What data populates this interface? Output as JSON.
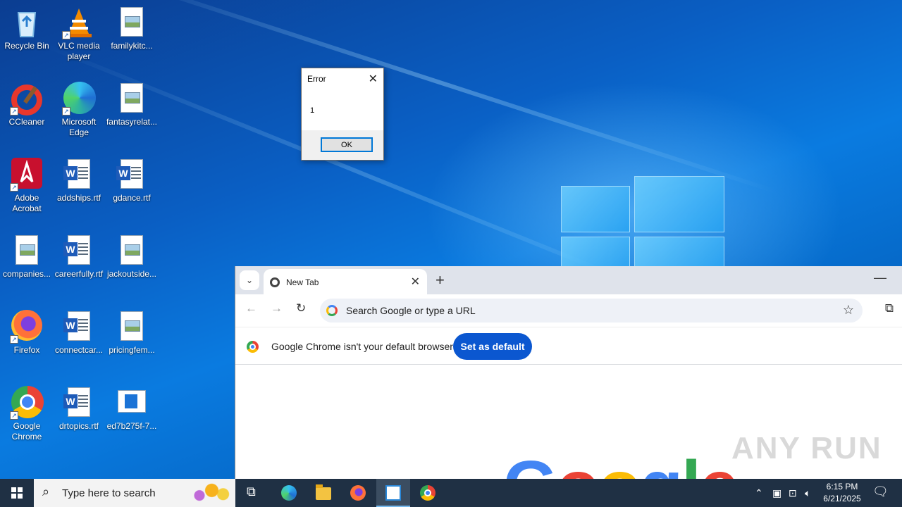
{
  "desktop": {
    "icons": [
      {
        "label": "Recycle Bin",
        "icon": "recycle-bin-icon"
      },
      {
        "label": "VLC media player",
        "icon": "vlc-icon"
      },
      {
        "label": "familykitc...",
        "icon": "image-file-icon"
      },
      {
        "label": "CCleaner",
        "icon": "ccleaner-icon"
      },
      {
        "label": "Microsoft Edge",
        "icon": "edge-icon"
      },
      {
        "label": "fantasyrelat...",
        "icon": "image-file-icon"
      },
      {
        "label": "Adobe Acrobat",
        "icon": "acrobat-icon"
      },
      {
        "label": "addships.rtf",
        "icon": "word-doc-icon"
      },
      {
        "label": "gdance.rtf",
        "icon": "word-doc-icon"
      },
      {
        "label": "companies...",
        "icon": "image-file-icon"
      },
      {
        "label": "careerfully.rtf",
        "icon": "word-doc-icon"
      },
      {
        "label": "jackoutside...",
        "icon": "image-file-icon"
      },
      {
        "label": "Firefox",
        "icon": "firefox-icon"
      },
      {
        "label": "connectcar...",
        "icon": "word-doc-icon"
      },
      {
        "label": "pricingfem...",
        "icon": "image-file-icon"
      },
      {
        "label": "Google Chrome",
        "icon": "chrome-icon"
      },
      {
        "label": "drtopics.rtf",
        "icon": "word-doc-icon"
      },
      {
        "label": "ed7b275f-7...",
        "icon": "generic-file-icon"
      }
    ]
  },
  "error_dialog": {
    "title": "Error",
    "message": "1",
    "ok_label": "OK"
  },
  "chrome": {
    "tab_title": "New Tab",
    "omnibox_placeholder": "Search Google or type a URL",
    "infobar_text": "Google Chrome isn't your default browser",
    "set_default_label": "Set as default",
    "logo_letters": [
      "G",
      "o",
      "o",
      "g",
      "l",
      "e"
    ]
  },
  "watermark": "ANY RUN",
  "taskbar": {
    "search_placeholder": "Type here to search",
    "time": "6:15 PM",
    "date": "6/21/2025"
  },
  "colors": {
    "taskbar": "#1f3044",
    "set_default_button": "#0b57d0",
    "dialog_ok_border": "#0078d7"
  }
}
